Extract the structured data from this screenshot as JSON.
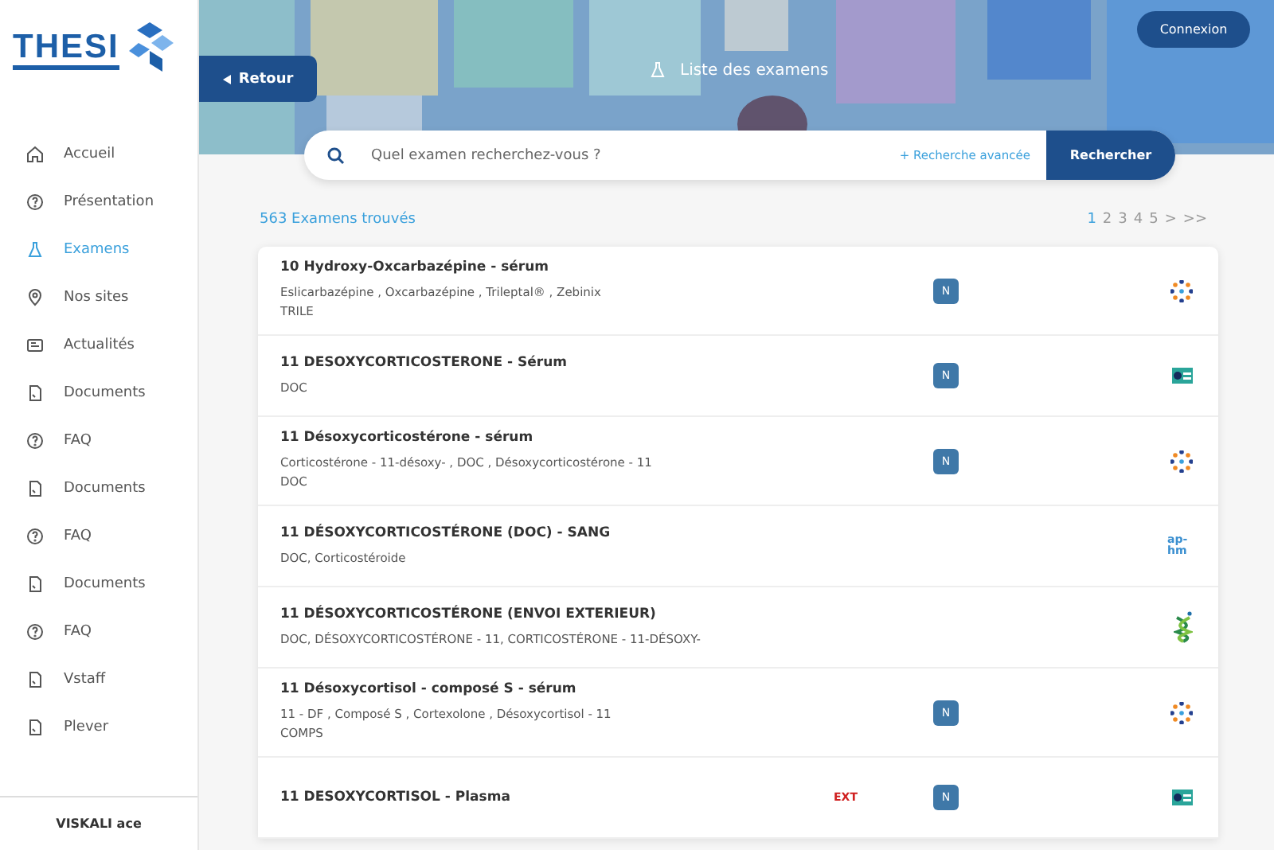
{
  "logo": {
    "text": "THESI"
  },
  "sidebar": {
    "items": [
      {
        "label": "Accueil",
        "kind": "home",
        "selected": false
      },
      {
        "label": "Présentation",
        "kind": "help",
        "selected": false
      },
      {
        "label": "Examens",
        "kind": "flask",
        "selected": true
      },
      {
        "label": "Nos sites",
        "kind": "pin",
        "selected": false
      },
      {
        "label": "Actualités",
        "kind": "news",
        "selected": false
      },
      {
        "label": "Documents",
        "kind": "doc",
        "selected": false
      },
      {
        "label": "FAQ",
        "kind": "help",
        "selected": false
      },
      {
        "label": "Documents",
        "kind": "doc",
        "selected": false
      },
      {
        "label": "FAQ",
        "kind": "help",
        "selected": false
      },
      {
        "label": "Documents",
        "kind": "doc",
        "selected": false
      },
      {
        "label": "FAQ",
        "kind": "help",
        "selected": false
      },
      {
        "label": "Vstaff",
        "kind": "doc",
        "selected": false
      },
      {
        "label": "Plever",
        "kind": "doc",
        "selected": false
      }
    ],
    "footer": "VISKALI ace"
  },
  "header": {
    "back": "Retour",
    "title": "Liste des examens",
    "login": "Connexion"
  },
  "search": {
    "placeholder": "Quel examen recherchez-vous ?",
    "advanced": "+ Recherche avancée",
    "button": "Rechercher"
  },
  "results": {
    "count": "563 Examens trouvés",
    "pages": [
      {
        "label": "1",
        "selected": true
      },
      {
        "label": "2",
        "selected": false
      },
      {
        "label": "3",
        "selected": false
      },
      {
        "label": "4",
        "selected": false
      },
      {
        "label": "5",
        "selected": false
      },
      {
        "label": ">",
        "selected": false
      },
      {
        "label": ">>",
        "selected": false
      }
    ]
  },
  "exams": [
    {
      "title": "10 Hydroxy-Oxcarbazépine - sérum",
      "lines": [
        "Eslicarbazépine , Oxcarbazépine , Trileptal® , Zebinix",
        "TRILE"
      ],
      "badge": "N",
      "lab": {
        "kind": "dots"
      }
    },
    {
      "title": "11 DESOXYCORTICOSTERONE - Sérum",
      "lines": [
        "DOC"
      ],
      "badge": "N",
      "lab": {
        "kind": "card"
      }
    },
    {
      "title": "11 Désoxycorticostérone - sérum",
      "lines": [
        "Corticostérone - 11-désoxy- , DOC , Désoxycorticostérone - 11",
        "DOC"
      ],
      "badge": "N",
      "lab": {
        "kind": "dots"
      }
    },
    {
      "title": "11 DÉSOXYCORTICOSTÉRONE (DOC) - SANG",
      "lines": [
        "DOC, Corticostéroide"
      ],
      "lab": {
        "kind": "text",
        "text": "ap-hm"
      }
    },
    {
      "title": "11 DÉSOXYCORTICOSTÉRONE (ENVOI EXTERIEUR)",
      "lines": [
        "DOC, DÉSOXYCORTICOSTÉRONE - 11, CORTICOSTÉRONE - 11-DÉSOXY-"
      ],
      "lab": {
        "kind": "helix"
      }
    },
    {
      "title": "11 Désoxycortisol - composé S - sérum",
      "lines": [
        "11 - DF , Composé S , Cortexolone , Désoxycortisol - 11",
        "COMPS"
      ],
      "badge": "N",
      "lab": {
        "kind": "dots"
      }
    },
    {
      "title": "11 DESOXYCORTISOL - Plasma",
      "ext": "EXT",
      "badge": "N",
      "lab": {
        "kind": "card"
      }
    }
  ]
}
